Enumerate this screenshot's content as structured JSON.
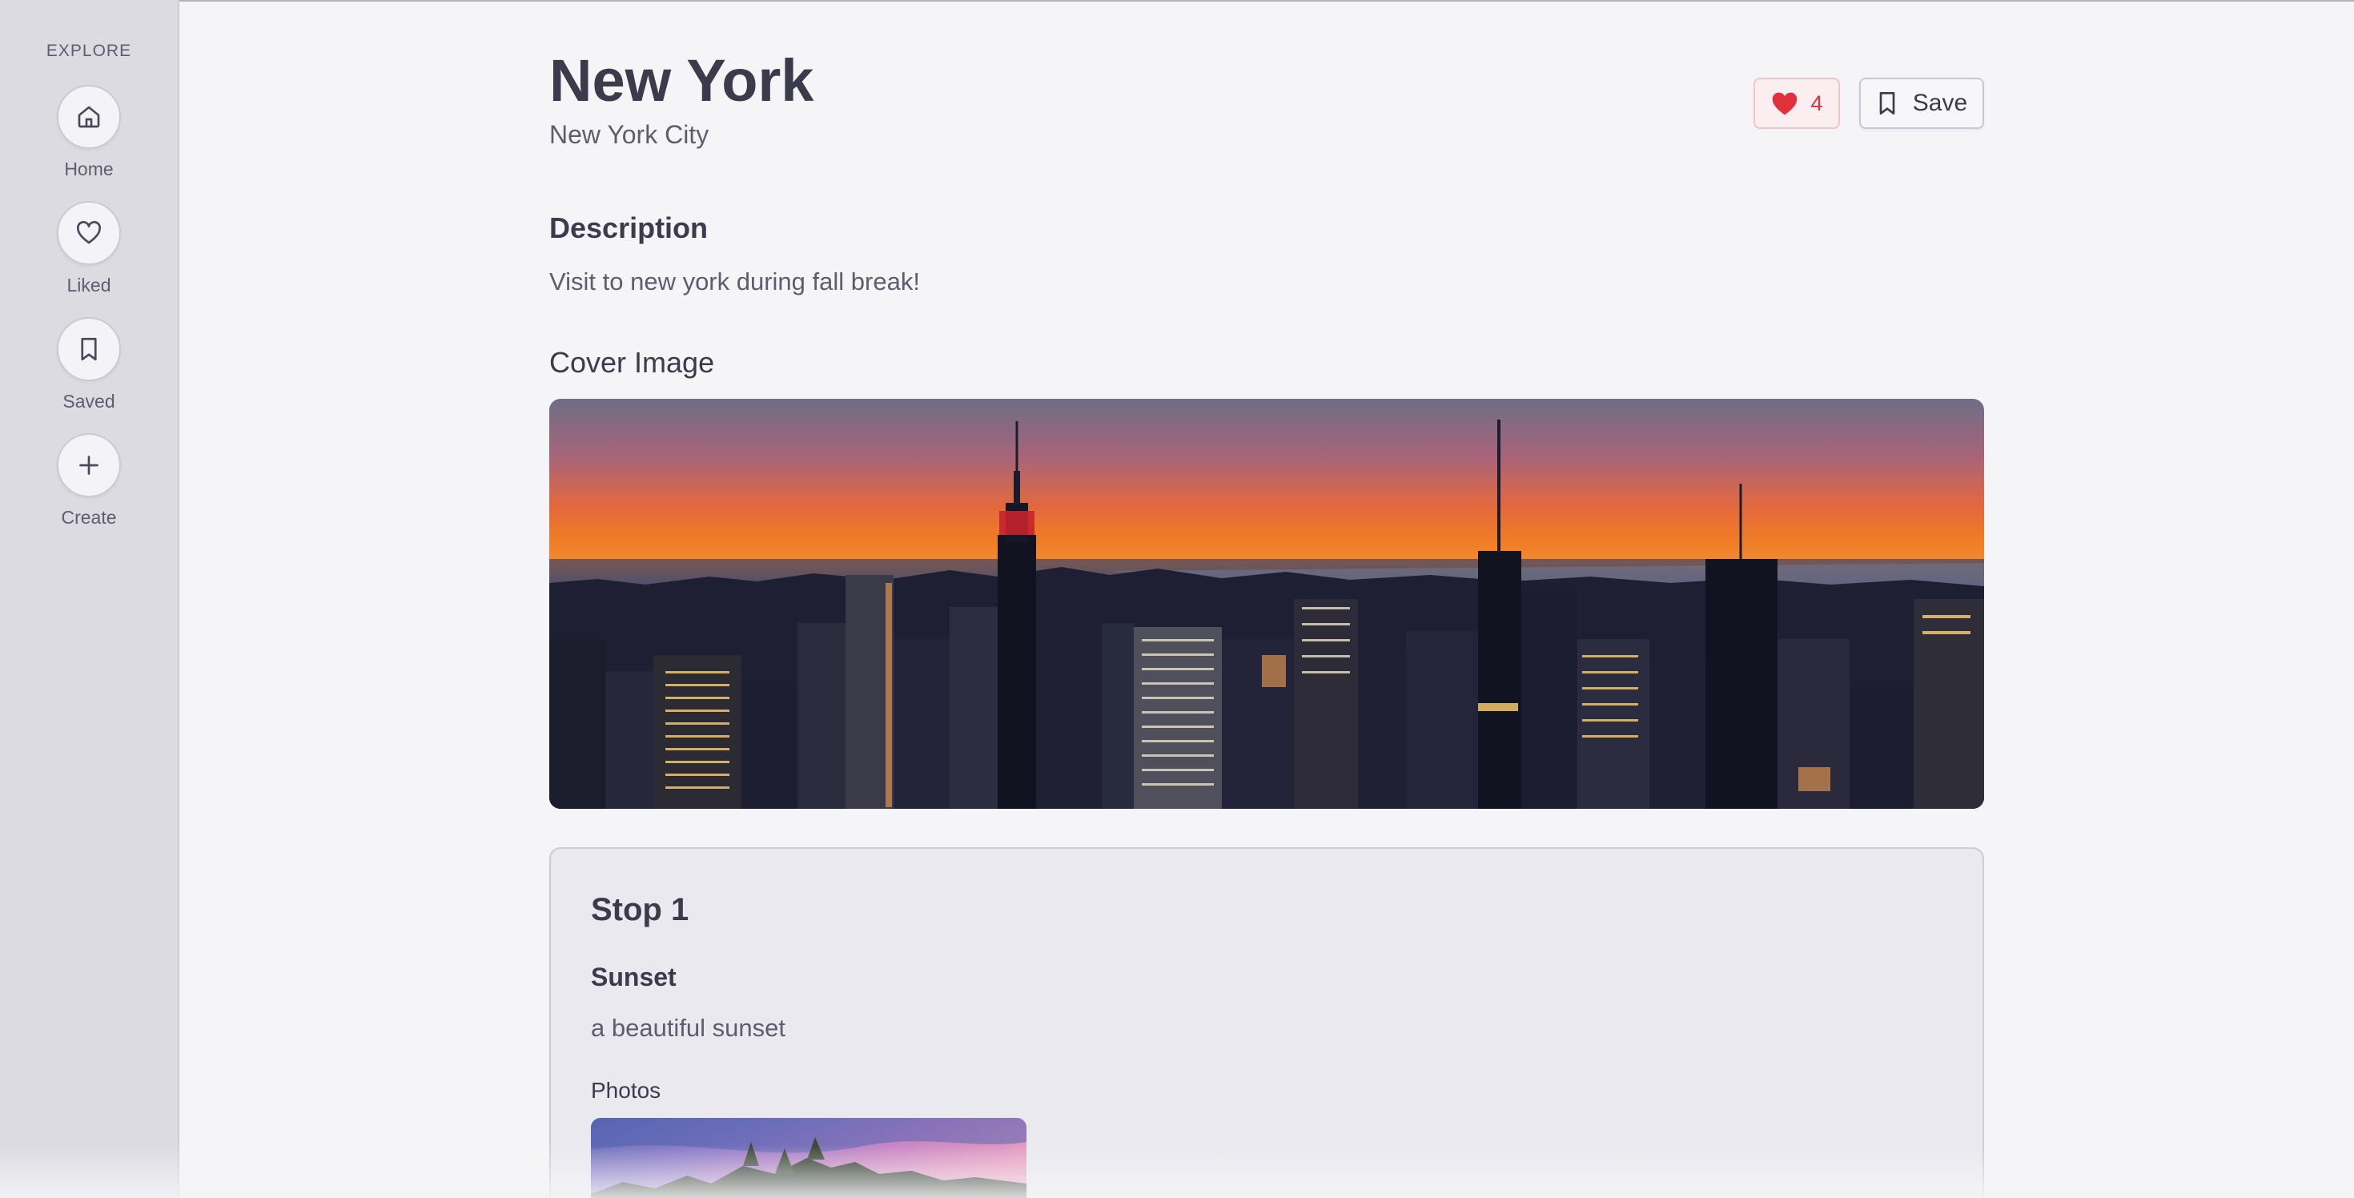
{
  "sidebar": {
    "heading": "EXPLORE",
    "items": [
      {
        "label": "Home",
        "icon": "home-icon"
      },
      {
        "label": "Liked",
        "icon": "heart-icon"
      },
      {
        "label": "Saved",
        "icon": "bookmark-icon"
      },
      {
        "label": "Create",
        "icon": "plus-icon"
      }
    ]
  },
  "header": {
    "title": "New York",
    "subtitle": "New York City",
    "like_count": "4",
    "save_label": "Save"
  },
  "description": {
    "heading": "Description",
    "text": "Visit to new york during fall break!"
  },
  "cover": {
    "label": "Cover Image"
  },
  "stops": [
    {
      "title": "Stop 1",
      "name": "Sunset",
      "description": "a beautiful sunset",
      "photos_label": "Photos"
    }
  ],
  "colors": {
    "like_red": "#e0323d",
    "sidebar_bg": "#dcdbe2",
    "page_bg": "#f5f5f8",
    "card_bg": "#eae9ef"
  }
}
